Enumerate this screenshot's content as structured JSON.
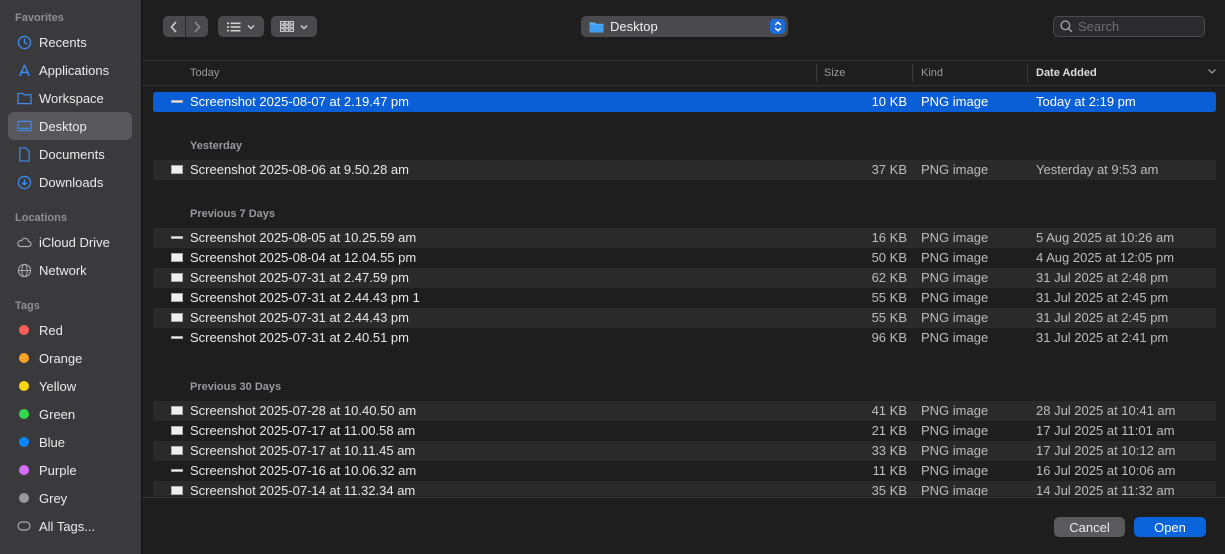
{
  "sidebar": {
    "favorites_label": "Favorites",
    "favorites": [
      {
        "label": "Recents",
        "icon": "clock-icon"
      },
      {
        "label": "Applications",
        "icon": "applications-icon"
      },
      {
        "label": "Workspace",
        "icon": "folder-icon"
      },
      {
        "label": "Desktop",
        "icon": "desktop-icon",
        "active": true
      },
      {
        "label": "Documents",
        "icon": "document-icon"
      },
      {
        "label": "Downloads",
        "icon": "download-icon"
      }
    ],
    "locations_label": "Locations",
    "locations": [
      {
        "label": "iCloud Drive",
        "icon": "cloud-icon"
      },
      {
        "label": "Network",
        "icon": "globe-icon"
      }
    ],
    "tags_label": "Tags",
    "tags": [
      {
        "label": "Red",
        "color": "#ff5f57"
      },
      {
        "label": "Orange",
        "color": "#ffa227"
      },
      {
        "label": "Yellow",
        "color": "#ffd60a"
      },
      {
        "label": "Green",
        "color": "#32d74b"
      },
      {
        "label": "Blue",
        "color": "#0a84ff"
      },
      {
        "label": "Purple",
        "color": "#d86eff"
      },
      {
        "label": "Grey",
        "color": "#98989d"
      }
    ],
    "all_tags_label": "All Tags..."
  },
  "toolbar": {
    "location": "Desktop",
    "search_placeholder": "Search"
  },
  "columns": {
    "name": "Today",
    "size": "Size",
    "kind": "Kind",
    "date": "Date Added"
  },
  "groups": [
    {
      "label": "",
      "files": [
        {
          "name": "Screenshot 2025-08-07 at 2.19.47 pm",
          "size": "10 KB",
          "kind": "PNG image",
          "date": "Today at 2:19 pm"
        }
      ]
    },
    {
      "label": "Yesterday",
      "files": [
        {
          "name": "Screenshot 2025-08-06 at 9.50.28 am",
          "size": "37 KB",
          "kind": "PNG image",
          "date": "Yesterday at 9:53 am"
        }
      ]
    },
    {
      "label": "Previous 7 Days",
      "files": [
        {
          "name": "Screenshot 2025-08-05 at 10.25.59 am",
          "size": "16 KB",
          "kind": "PNG image",
          "date": "5 Aug 2025 at 10:26 am"
        },
        {
          "name": "Screenshot 2025-08-04 at 12.04.55 pm",
          "size": "50 KB",
          "kind": "PNG image",
          "date": "4 Aug 2025 at 12:05 pm"
        },
        {
          "name": "Screenshot 2025-07-31 at 2.47.59 pm",
          "size": "62 KB",
          "kind": "PNG image",
          "date": "31 Jul 2025 at 2:48 pm"
        },
        {
          "name": "Screenshot 2025-07-31 at 2.44.43 pm 1",
          "size": "55 KB",
          "kind": "PNG image",
          "date": "31 Jul 2025 at 2:45 pm"
        },
        {
          "name": "Screenshot 2025-07-31 at 2.44.43 pm",
          "size": "55 KB",
          "kind": "PNG image",
          "date": "31 Jul 2025 at 2:45 pm"
        },
        {
          "name": "Screenshot 2025-07-31 at 2.40.51 pm",
          "size": "96 KB",
          "kind": "PNG image",
          "date": "31 Jul 2025 at 2:41 pm"
        }
      ]
    },
    {
      "label": "Previous 30 Days",
      "files": [
        {
          "name": "Screenshot 2025-07-28 at 10.40.50 am",
          "size": "41 KB",
          "kind": "PNG image",
          "date": "28 Jul 2025 at 10:41 am"
        },
        {
          "name": "Screenshot 2025-07-17 at 11.00.58 am",
          "size": "21 KB",
          "kind": "PNG image",
          "date": "17 Jul 2025 at 11:01 am"
        },
        {
          "name": "Screenshot 2025-07-17 at 10.11.45 am",
          "size": "33 KB",
          "kind": "PNG image",
          "date": "17 Jul 2025 at 10:12 am"
        },
        {
          "name": "Screenshot 2025-07-16 at 10.06.32 am",
          "size": "11 KB",
          "kind": "PNG image",
          "date": "16 Jul 2025 at 10:06 am"
        },
        {
          "name": "Screenshot 2025-07-14 at 11.32.34 am",
          "size": "35 KB",
          "kind": "PNG image",
          "date": "14 Jul 2025 at 11:32 am"
        }
      ]
    }
  ],
  "footer": {
    "cancel": "Cancel",
    "open": "Open"
  }
}
